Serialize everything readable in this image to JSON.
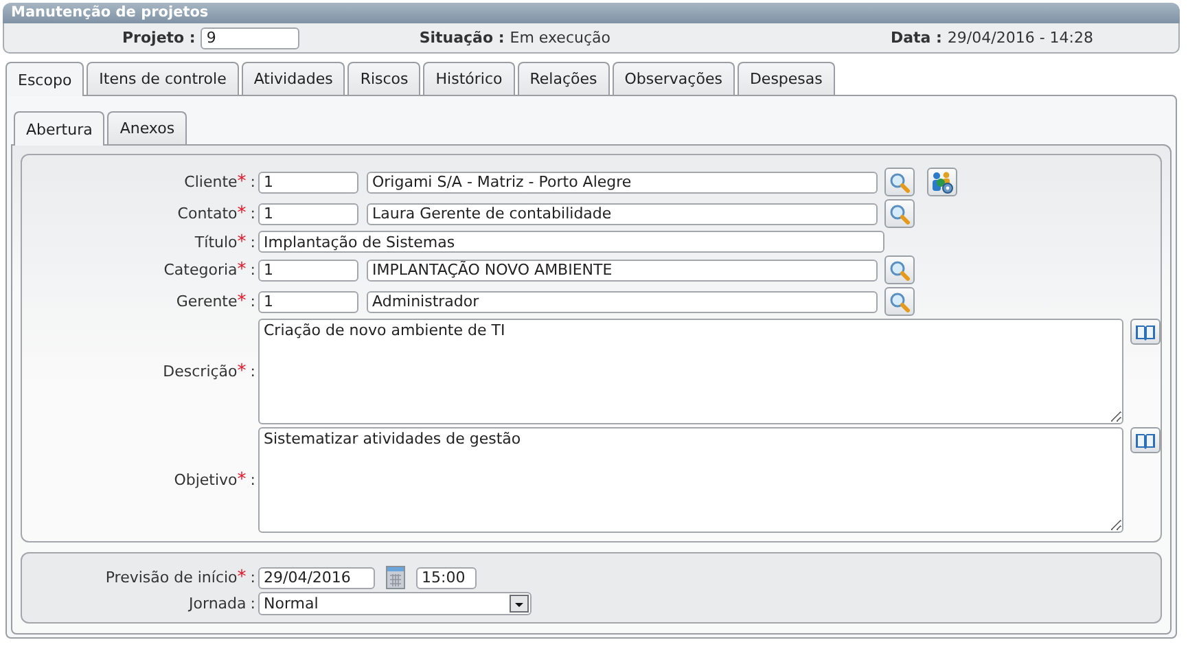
{
  "window": {
    "title": "Manutenção de projetos"
  },
  "header": {
    "project_label": "Projeto :",
    "project_value": "9",
    "status_label": "Situação :",
    "status_value": "Em execução",
    "date_label": "Data :",
    "date_value": "29/04/2016 - 14:28"
  },
  "tabs": [
    {
      "label": "Escopo",
      "selected": true
    },
    {
      "label": "Itens de controle",
      "selected": false
    },
    {
      "label": "Atividades",
      "selected": false
    },
    {
      "label": "Riscos",
      "selected": false
    },
    {
      "label": "Histórico",
      "selected": false
    },
    {
      "label": "Relações",
      "selected": false
    },
    {
      "label": "Observações",
      "selected": false
    },
    {
      "label": "Despesas",
      "selected": false
    }
  ],
  "subtabs": [
    {
      "label": "Abertura",
      "selected": true
    },
    {
      "label": "Anexos",
      "selected": false
    }
  ],
  "sections": [
    {
      "fields": [
        {
          "kind": "lookup",
          "label": "Cliente",
          "required_mark": "*",
          "separator": ":",
          "code": "1",
          "value": "Origami S/A - Matriz - Porto Alegre",
          "extra_button": true
        },
        {
          "kind": "lookup",
          "label": "Contato",
          "required_mark": "*",
          "separator": ":",
          "code": "1",
          "value": "Laura Gerente de contabilidade",
          "extra_button": false
        },
        {
          "kind": "text",
          "label": "Título",
          "required_mark": "*",
          "separator": ":",
          "value": "Implantação de Sistemas"
        },
        {
          "kind": "lookup",
          "label": "Categoria",
          "required_mark": "*",
          "separator": ":",
          "code": "1",
          "value": "IMPLANTAÇÃO NOVO AMBIENTE",
          "extra_button": false
        },
        {
          "kind": "lookup",
          "label": "Gerente",
          "required_mark": "*",
          "separator": ":",
          "code": "1",
          "value": "Administrador",
          "extra_button": false
        },
        {
          "kind": "textarea",
          "label": "Descrição",
          "required_mark": "*",
          "separator": ":",
          "value": "Criação de novo ambiente de TI"
        },
        {
          "kind": "textarea",
          "label": "Objetivo",
          "required_mark": "*",
          "separator": ":",
          "value": "Sistematizar atividades de gestão"
        }
      ]
    },
    {
      "fields": [
        {
          "kind": "datetime",
          "label": "Previsão de início",
          "required_mark": "*",
          "separator": ":",
          "date": "29/04/2016",
          "time": "15:00"
        },
        {
          "kind": "select",
          "label": "Jornada",
          "separator": ":",
          "value": "Normal"
        }
      ]
    }
  ]
}
